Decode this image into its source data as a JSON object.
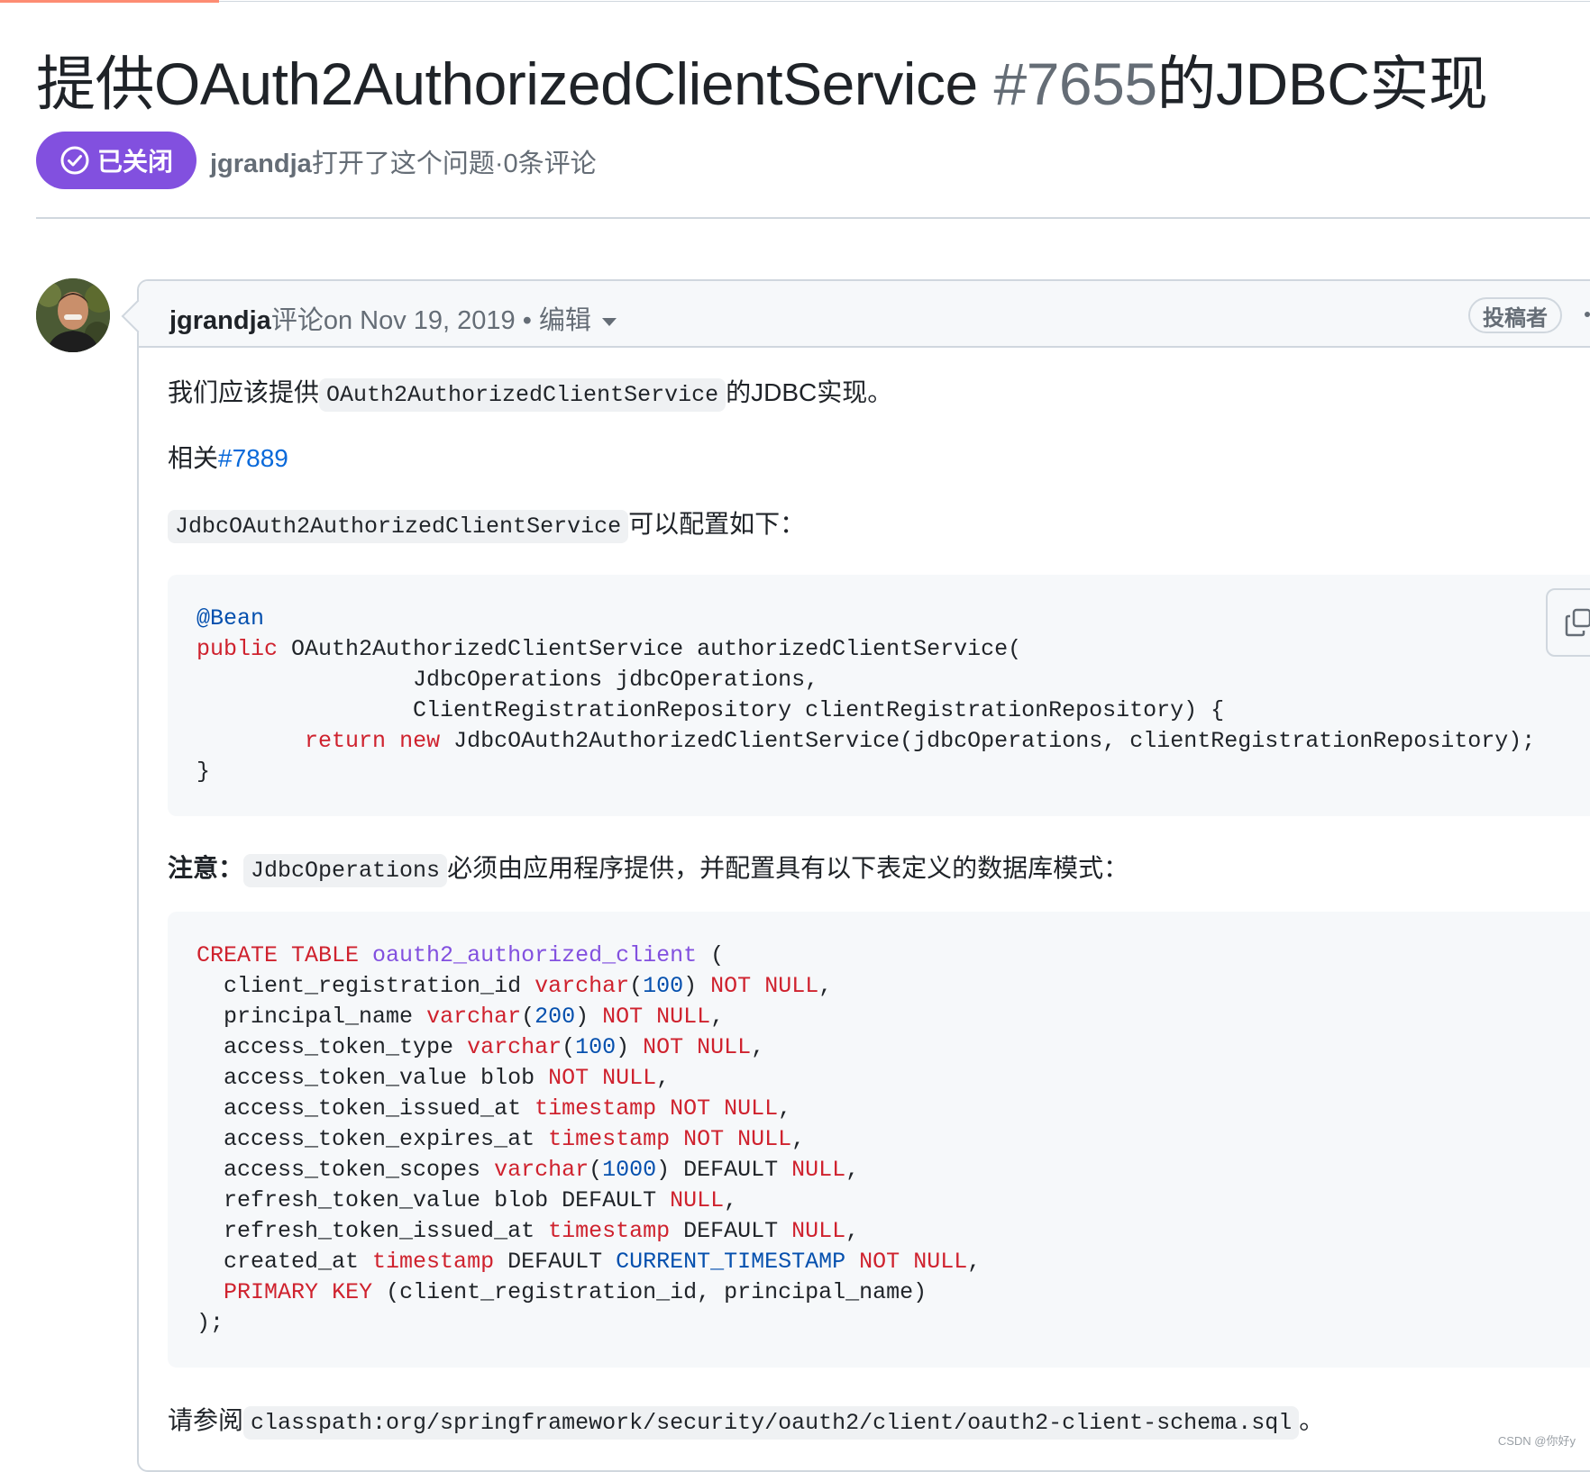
{
  "issue": {
    "title_prefix": "提供OAuth2AuthorizedClientService ",
    "number": "#7655",
    "title_suffix": "的JDBC实现",
    "state": "已关闭",
    "author": "jgrandja",
    "meta_text": "打开了这个问题·0条评论"
  },
  "comment": {
    "author": "jgrandja",
    "action": "评论on Nov 19, 2019 • 编辑",
    "role": "投稿者",
    "p1_before": "我们应该提供",
    "p1_code": "OAuth2AuthorizedClientService",
    "p1_after": "的JDBC实现。",
    "p2_label": "相关",
    "p2_link": "#7889",
    "p3_code": "JdbcOAuth2AuthorizedClientService",
    "p3_after": "可以配置如下：",
    "java": {
      "annotation": "@Bean",
      "kw_public": "public",
      "sig": " OAuth2AuthorizedClientService authorizedClientService(",
      "arg1": "                JdbcOperations jdbcOperations,",
      "arg2": "                ClientRegistrationRepository clientRegistrationRepository) {",
      "indent": "        ",
      "kw_return": "return",
      "kw_new": "new",
      "ret_expr": " JdbcOAuth2AuthorizedClientService(jdbcOperations, clientRegistrationRepository);",
      "close": "}"
    },
    "note_label": "注意：",
    "note_code": "JdbcOperations",
    "note_after": "必须由应用程序提供，并配置具有以下表定义的数据库模式：",
    "sql": {
      "create": "CREATE TABLE",
      "table_name": "oauth2_authorized_client",
      "lines": [
        "client_registration_id varchar(100) NOT NULL,",
        "principal_name varchar(200) NOT NULL,",
        "access_token_type varchar(100) NOT NULL,",
        "access_token_value blob NOT NULL,",
        "access_token_issued_at timestamp NOT NULL,",
        "access_token_expires_at timestamp NOT NULL,",
        "access_token_scopes varchar(1000) DEFAULT NULL,",
        "refresh_token_value blob DEFAULT NULL,",
        "refresh_token_issued_at timestamp DEFAULT NULL,",
        "created_at timestamp DEFAULT CURRENT_TIMESTAMP NOT NULL,",
        "PRIMARY KEY (client_registration_id, principal_name)"
      ],
      "close": ");"
    },
    "see_label": "请参阅",
    "see_code": "classpath:org/springframework/security/oauth2/client/oauth2-client-schema.sql",
    "see_after": "。"
  },
  "watermark": "CSDN @你好y",
  "colors": {
    "closed_badge": "#8250df",
    "link": "#0969da",
    "keyword": "#cf222e",
    "constant": "#0550ae",
    "entity": "#8250df"
  }
}
